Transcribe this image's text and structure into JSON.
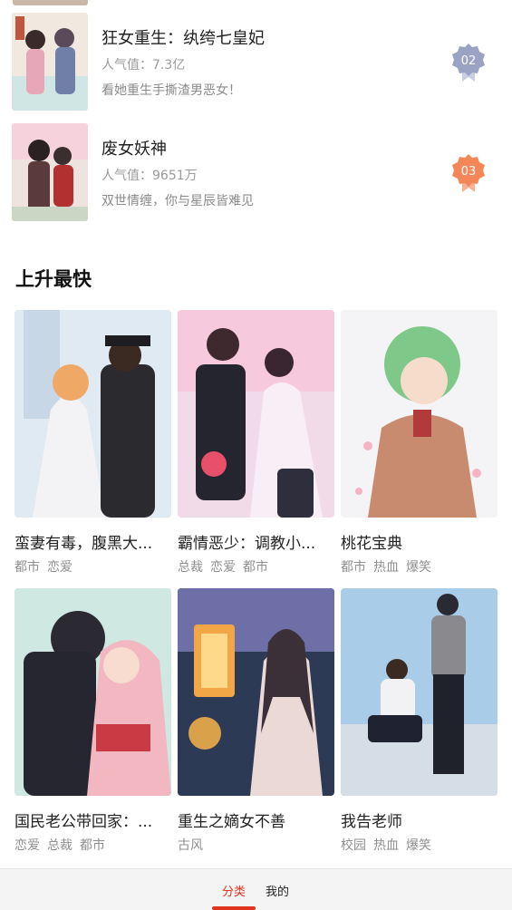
{
  "ranking": [
    {
      "title": "狂女重生：纨绔七皇妃",
      "popularity": "人气值：7.3亿",
      "desc": "看她重生手撕渣男恶女！",
      "rank": "02",
      "badge_color": "#9aa3c4"
    },
    {
      "title": "废女妖神",
      "popularity": "人气值：9651万",
      "desc": "双世情缠，你与星辰皆难见",
      "rank": "03",
      "badge_color": "#f4875a"
    }
  ],
  "section": {
    "title": "上升最快"
  },
  "cards": [
    {
      "title": "蛮妻有毒，腹黑大...",
      "tags": [
        "都市",
        "恋爱"
      ]
    },
    {
      "title": "霸情恶少：调教小...",
      "tags": [
        "总裁",
        "恋爱",
        "都市"
      ]
    },
    {
      "title": "桃花宝典",
      "tags": [
        "都市",
        "热血",
        "爆笑"
      ]
    },
    {
      "title": "国民老公带回家：...",
      "tags": [
        "恋爱",
        "总裁",
        "都市"
      ]
    },
    {
      "title": "重生之嫡女不善",
      "tags": [
        "古风"
      ]
    },
    {
      "title": "我告老师",
      "tags": [
        "校园",
        "热血",
        "爆笑"
      ]
    }
  ],
  "nav": {
    "category": "分类",
    "mine": "我的"
  },
  "colors": {
    "accent": "#e0341f"
  }
}
